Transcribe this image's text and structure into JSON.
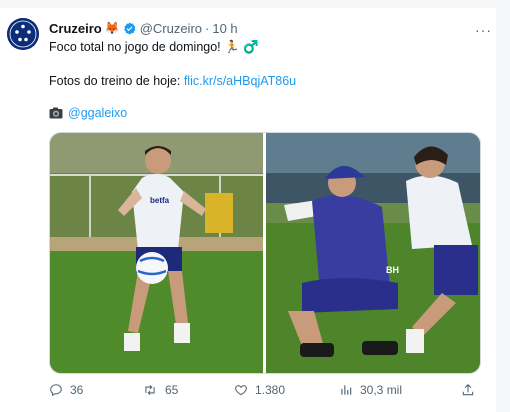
{
  "tweet": {
    "author_name": "Cruzeiro",
    "author_emoji": "🦊",
    "handle": "@Cruzeiro",
    "separator": "·",
    "time": "10 h",
    "line1": "Foco total no jogo de domingo! 🏃 ♂️",
    "line2_prefix": "Fotos do treino de hoje: ",
    "line2_link": "flic.kr/s/aHBqjAT86u",
    "credit_handle": "@ggaleixo",
    "more_label": "···"
  },
  "actions": {
    "replies": "36",
    "retweets": "65",
    "likes": "1.380",
    "views": "30,3 mil"
  },
  "photos": [
    {
      "jersey_text": "betfa"
    },
    {
      "jersey_text": "BH"
    }
  ],
  "colors": {
    "link": "#1d9bf0",
    "secondary_text": "#536471",
    "verified_badge": "#1d9bf0",
    "club_blue": "#0d2c7a"
  }
}
